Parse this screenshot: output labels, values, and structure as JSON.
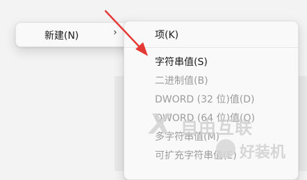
{
  "main_menu": {
    "new_label": "新建(N)",
    "arrow": "›"
  },
  "sub_menu": {
    "items": [
      {
        "label": "项(K)",
        "disabled": false
      },
      {
        "label": "字符串值(S)",
        "disabled": false
      },
      {
        "label": "二进制值(B)",
        "disabled": true
      },
      {
        "label": "DWORD (32 位)值(D)",
        "disabled": true
      },
      {
        "label": "QWORD (64 位)值(Q)",
        "disabled": true
      },
      {
        "label": "多字符串值(M)",
        "disabled": true
      },
      {
        "label": "可扩充字符串值(E)",
        "disabled": true
      }
    ]
  },
  "watermark": {
    "brand1": "自由互联",
    "brand2": "好装机",
    "x_mark": "X"
  },
  "colors": {
    "annotation_arrow": "#e53935",
    "menu_bg": "#f9f9f9",
    "disabled_text": "#9b9b9b"
  }
}
